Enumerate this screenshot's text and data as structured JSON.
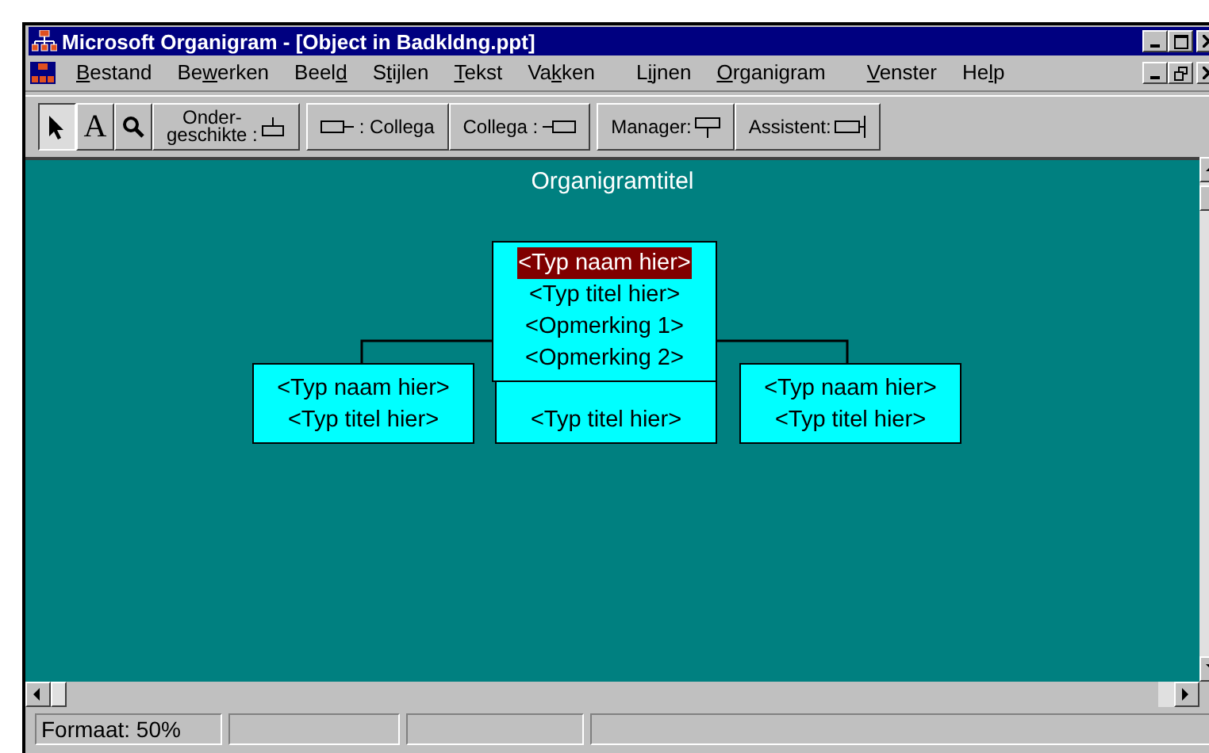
{
  "window": {
    "title": "Microsoft Organigram - [Object in Badkldng.ppt]"
  },
  "menu": [
    {
      "key": "B",
      "after": "estand"
    },
    {
      "before": "Be",
      "key": "w",
      "after": "erken"
    },
    {
      "before": "Beel",
      "key": "d"
    },
    {
      "before": "S",
      "key": "t",
      "after": "ijlen"
    },
    {
      "key": "T",
      "after": "ekst"
    },
    {
      "before": "Va",
      "key": "k",
      "after": "ken"
    },
    {
      "before": "L",
      "key": "i",
      "after": "jnen"
    },
    {
      "key": "O",
      "after": "rganigram"
    },
    {
      "key": "V",
      "after": "enster"
    },
    {
      "before": "He",
      "key": "l",
      "after": "p"
    }
  ],
  "tools": [
    {
      "kind": "pointer",
      "selected": true
    },
    {
      "kind": "text",
      "label": "A",
      "selected": false
    },
    {
      "kind": "zoom",
      "selected": false
    }
  ],
  "shape_buttons": [
    {
      "kind": "subordinate",
      "label": "Onder-\ngeschikte :"
    },
    {
      "kind": "left-coworker",
      "label": ": Collega"
    },
    {
      "kind": "right-coworker",
      "label": "Collega :"
    },
    {
      "kind": "manager",
      "label": "Manager:"
    },
    {
      "kind": "assistant",
      "label": "Assistent:"
    }
  ],
  "chart": {
    "title": "Organigramtitel",
    "manager": {
      "lines": [
        {
          "text": "<Typ naam hier>",
          "selected": true
        },
        {
          "text": "<Typ titel hier>",
          "selected": false
        },
        {
          "text": "<Opmerking 1>",
          "selected": false
        },
        {
          "text": "<Opmerking 2>",
          "selected": false
        }
      ]
    },
    "subordinates": [
      {
        "lines": [
          "<Typ naam hier>",
          "<Typ titel hier>"
        ]
      },
      {
        "lines": [
          "<Typ titel hier>"
        ],
        "covered_top": true
      },
      {
        "lines": [
          "<Typ naam hier>",
          "<Typ titel hier>"
        ]
      }
    ]
  },
  "status_bar": [
    "Formaat: 50%"
  ]
}
